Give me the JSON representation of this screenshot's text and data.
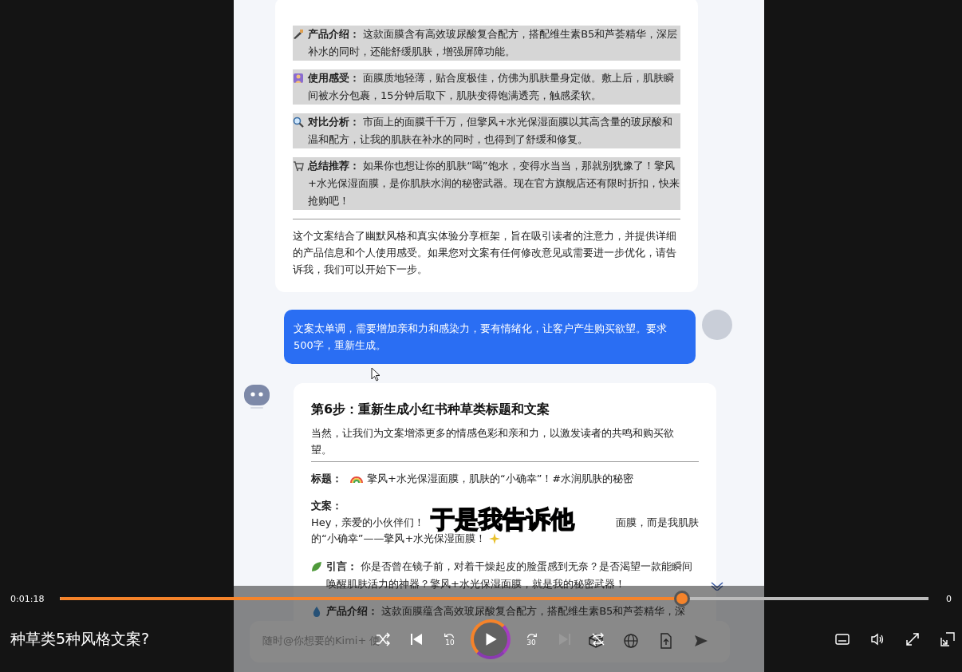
{
  "chat": {
    "sections": [
      {
        "kind": "pen",
        "label": "产品介绍：",
        "text": "这款面膜含有高效玻尿酸复合配方，搭配维生素B5和芦荟精华，深层补水的同时，还能舒缓肌肤，增强屏障功能。",
        "selected": true
      },
      {
        "kind": "person",
        "label": "使用感受：",
        "text": "面膜质地轻薄，贴合度极佳，仿佛为肌肤量身定做。敷上后，肌肤瞬间被水分包裹，15分钟后取下，肌肤变得饱满透亮，触感柔软。",
        "selected": true
      },
      {
        "kind": "magnifier",
        "label": "对比分析：",
        "text": "市面上的面膜千千万，但擎风+水光保湿面膜以其高含量的玻尿酸和温和配方，让我的肌肤在补水的同时，也得到了舒缓和修复。",
        "selected": true
      },
      {
        "kind": "cart",
        "label": "总结推荐：",
        "text": "如果你也想让你的肌肤“喝”饱水，变得水当当，那就别犹豫了！擎风+水光保湿面膜，是你肌肤水润的秘密武器。现在官方旗舰店还有限时折扣，快来抢购吧！",
        "selected": true
      }
    ],
    "summary": "这个文案结合了幽默风格和真实体验分享框架，旨在吸引读者的注意力，并提供详细的产品信息和个人使用感受。如果您对文案有任何修改意见或需要进一步优化，请告诉我，我们可以开始下一步。",
    "user_message": "文案太单调，需要增加亲和力和感染力，要有情绪化，让客户产生购买欲望。要求500字，重新生成。",
    "reply": {
      "heading": "第6步：重新生成小红书种草类标题和文案",
      "intro": "当然，让我们为文案增添更多的情感色彩和亲和力，以激发读者的共鸣和购买欲望。",
      "title_label": "标题：",
      "title_text": "擎风+水光保湿面膜，肌肤的“小确幸”！#水润肌肤的秘密",
      "copy_label": "文案：",
      "copy_start": "Hey，亲爱的小伙伴们！",
      "copy_after_caption": "面膜，而是我肌肤",
      "copy_end": "的“小确幸”——擎风+水光保湿面膜！",
      "items": [
        {
          "kind": "leaf",
          "label": "引言：",
          "text": "你是否曾在镜子前，对着干燥起皮的脸蛋感到无奈？是否渴望一款能瞬间唤醒肌肤活力的神器？擎风+水光保湿面膜，就是我的秘密武器！"
        },
        {
          "kind": "drop",
          "label": "产品介绍：",
          "text": "这款面膜蕴含高效玻尿酸复合配方，搭配维生素B5和芦荟精华，深"
        }
      ]
    },
    "input": {
      "placeholder": "随时@你想要的Kimi+ 使"
    }
  },
  "player": {
    "caption": "于是我告诉他",
    "current_time": "0:01:18",
    "total_time": "0",
    "progress": {
      "level": 0.716
    },
    "title": "种草类5种风格文案?",
    "rewind_label": "10",
    "forward_label": "30"
  }
}
